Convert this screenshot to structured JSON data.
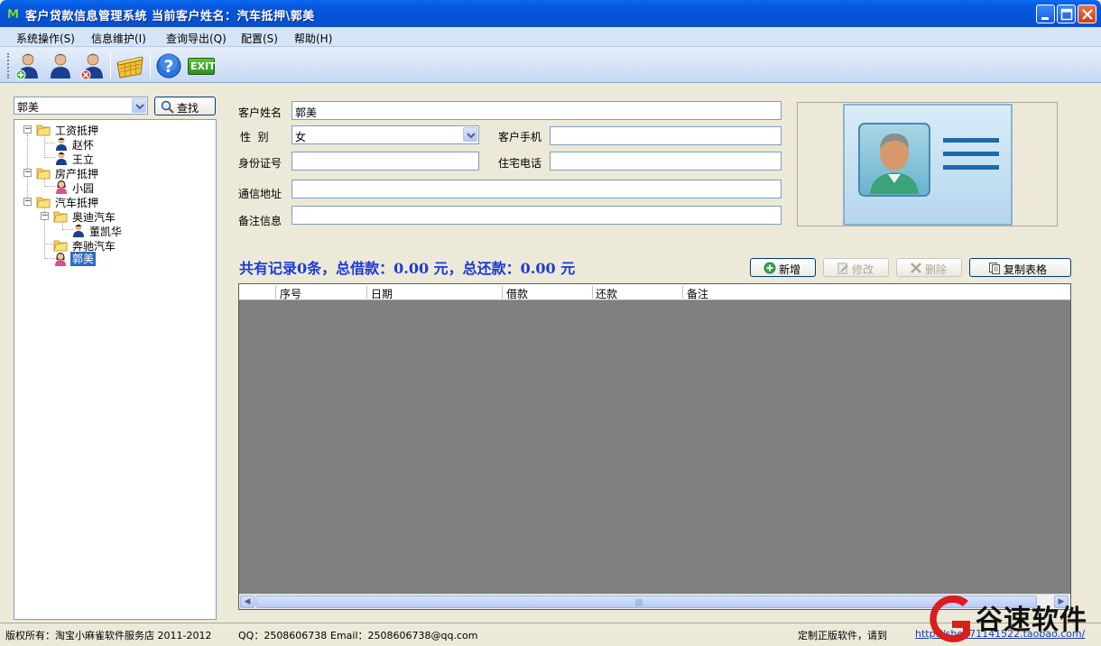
{
  "window": {
    "title": "客户贷款信息管理系统   当前客户姓名：汽车抵押\\郭美"
  },
  "menu": [
    {
      "label": "系统操作(S)"
    },
    {
      "label": "信息维护(I)"
    },
    {
      "label": "查询导出(Q)"
    },
    {
      "label": "配置(S)"
    },
    {
      "label": "帮助(H)"
    }
  ],
  "toolbar": {
    "icons": [
      "add-user-icon",
      "user-icon",
      "delete-user-icon",
      "basket-icon",
      "help-icon",
      "exit-icon"
    ],
    "exit_label": "EXIT"
  },
  "search": {
    "value": "郭美",
    "button_label": "查找"
  },
  "tree": [
    {
      "label": "工资抵押",
      "type": "folder",
      "expander": "−"
    },
    {
      "label": "赵怀",
      "type": "person"
    },
    {
      "label": "王立",
      "type": "person"
    },
    {
      "label": "房产抵押",
      "type": "folder",
      "expander": "−"
    },
    {
      "label": "小园",
      "type": "person-female"
    },
    {
      "label": "汽车抵押",
      "type": "folder",
      "expander": "−"
    },
    {
      "label": "奥迪汽车",
      "type": "folder",
      "expander": "−"
    },
    {
      "label": "董凯华",
      "type": "person"
    },
    {
      "label": "奔驰汽车",
      "type": "folder"
    },
    {
      "label": "郭美",
      "type": "person-female",
      "selected": true
    }
  ],
  "form": {
    "name_label": "客户姓名",
    "name_value": "郭美",
    "gender_label": "性  别",
    "gender_value": "女",
    "mobile_label": "客户手机",
    "mobile_value": "",
    "idcard_label": "身份证号",
    "idcard_value": "",
    "homephone_label": "住宅电话",
    "homephone_value": "",
    "address_label": "通信地址",
    "address_value": "",
    "remark_label": "备注信息",
    "remark_value": ""
  },
  "summary": "共有记录0条，总借款：0.00 元，总还款：0.00 元",
  "actions": {
    "add": "新增",
    "edit": "修改",
    "delete": "删除",
    "copy": "复制表格"
  },
  "grid": {
    "columns": [
      "序号",
      "日期",
      "借款",
      "还款",
      "备注"
    ],
    "rows": []
  },
  "status": {
    "copyright": "版权所有：淘宝小麻雀软件服务店 2011-2012",
    "qq": "QQ：2508606738",
    "email": "Email：2508606738@qq.com",
    "custom": "定制正版软件，请到",
    "link": "http://shop71141522.taobao.com/"
  },
  "watermark": {
    "text": "谷速软件",
    "url": "www.gusuwang.com"
  },
  "colors": {
    "titlebar": "#0553d8",
    "summary_text": "#1c3bd4",
    "grid_background": "#808080",
    "selection": "#316ac5"
  }
}
